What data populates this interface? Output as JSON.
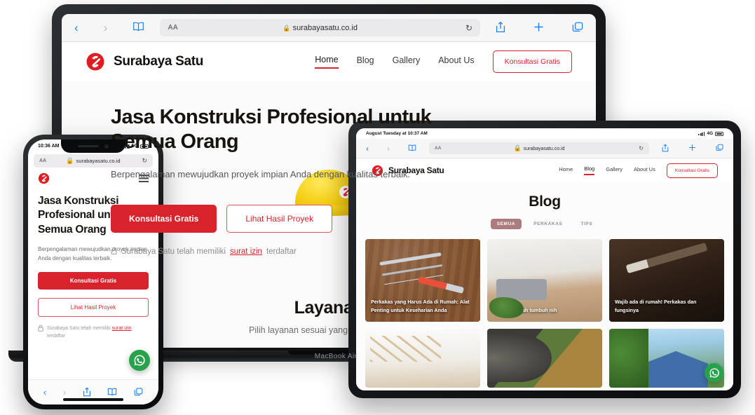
{
  "site": {
    "brand": "Surabaya Satu",
    "url": "surabayasatu.co.id",
    "nav": [
      "Home",
      "Blog",
      "Gallery",
      "About Us"
    ],
    "cta": "Konsultasi Gratis"
  },
  "browser": {
    "aa_label": "AA",
    "lock_glyph": "🔒",
    "reload_glyph": "↻",
    "back_glyph": "‹",
    "forward_glyph": "›",
    "book_glyph": "📖",
    "share_glyph": "⤴",
    "plus_glyph": "+",
    "tabs_glyph": "❐"
  },
  "laptop": {
    "model_label": "MacBook Air",
    "hero": {
      "heading": "Jasa Konstruksi Profesional untuk Semua Orang",
      "subheading": "Berpengalaman mewujudkan proyek impian Anda dengan kualitas terbaik.",
      "primary_button": "Konsultasi Gratis",
      "secondary_button": "Lihat Hasil Proyek",
      "note_prefix": "Surabaya Satu telah memiliki",
      "note_link": "surat izin",
      "note_suffix": "terdaftar"
    },
    "services": {
      "title": "Layanan",
      "subtitle": "Pilih layanan sesuai yang Anda butuhkan"
    }
  },
  "phone": {
    "status_time": "10:36 AM",
    "network": "5G",
    "heading": "Jasa Konstruksi Profesional untuk Semua Orang",
    "subheading": "Berpengalaman mewujudkan proyek impian Anda dengan kualitas terbaik.",
    "primary_button": "Konsultasi Gratis",
    "secondary_button": "Lihat Hasil Proyek",
    "note_prefix": "Surabaya Satu telah memiliki",
    "note_link": "surat izin",
    "note_suffix": "terdaftar"
  },
  "tablet": {
    "status_text": "August Tuesday at 10:37 AM",
    "network": "4G",
    "active_nav": "Blog",
    "blog": {
      "title": "Blog",
      "filters": [
        "SEMUA",
        "PERKAKAS",
        "TIPS"
      ],
      "active_filter": "SEMUA",
      "cards": [
        {
          "caption": "Perkakas yang Harus Ada di Rumah: Alat Penting untuk Keseharian Anda",
          "image": "tools-on-wood"
        },
        {
          "caption": "Konsep rumah tumbuh nih",
          "image": "living-room"
        },
        {
          "caption": "Wajib ada di rumah! Perkakas dan fungsinya",
          "image": "hammer-dark"
        },
        {
          "caption": "",
          "image": "attic-interior"
        },
        {
          "caption": "",
          "image": "wood-chipper"
        },
        {
          "caption": "",
          "image": "blue-house"
        }
      ]
    }
  },
  "colors": {
    "accent_red": "#d9232c",
    "whatsapp_green": "#25a24a",
    "pill_active": "#ab7b7d",
    "safari_blue": "#1b82f7"
  }
}
